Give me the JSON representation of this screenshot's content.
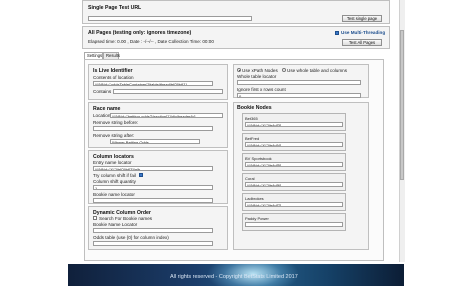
{
  "single_page": {
    "title": "Single Page Test URL",
    "url_value": "",
    "button_label": "Test single page"
  },
  "all_pages": {
    "title": "All Pages (testing only: ignores timezone)",
    "elapsed_text": "Elapsed time: 0.00 , Date : -/--/-- , Date Collection Time: 00:00",
    "multi_threading_label": "Use Multi-Threading",
    "multi_threading_checked": true,
    "button_label": "Test All Pages"
  },
  "tabs": [
    {
      "label": "Settings",
      "active": true
    },
    {
      "label": "Results",
      "active": false
    }
  ],
  "live_identifier": {
    "title": "Is Live Identifier",
    "contents_label": "Contents of location",
    "contents_value": "//*[@id=\"oddsTableContainer\"]/table/thead/tr[0]/td[1]",
    "contains_label": "Contains",
    "contains_value": ""
  },
  "race_name": {
    "title": "Race name",
    "location_label": "Location",
    "location_value": "//*[@id=\"betting-odds\"]/section[1]/div/header/h1",
    "remove_before_label": "Remove string before:",
    "remove_before_value": "",
    "remove_after_label": "Remove string after:",
    "remove_after_value": "Winner Betting Odds"
  },
  "column_locators": {
    "title": "Column locators",
    "entry_label": "Entry name locator",
    "entry_value": "//*[@id=\"t1\"]/tr[0]/td[3]/a/b",
    "try_shift_label": "Try column shift if fail",
    "try_shift_checked": true,
    "shift_qty_label": "Column shift quantity",
    "shift_qty_value": "1",
    "bookie_locator_label": "Bookie name locator",
    "bookie_locator_value": ""
  },
  "dynamic_order": {
    "title": "Dynamic Column Order",
    "search_label": "Search For Bookie names",
    "search_checked": false,
    "bookie_locator_label": "Bookie Name Locator",
    "bookie_locator_value": "",
    "odds_table_label": "Odds table (use {0} for column index)",
    "odds_table_value": ""
  },
  "xpath_mode": {
    "option_xpath_label": "Use xPath Nodes",
    "option_xpath_checked": true,
    "option_whole_label": "Use whole table and columns",
    "option_whole_checked": false,
    "whole_table_label": "Whole table locator",
    "whole_table_value": "",
    "ignore_rows_label": "Ignore first x rows count",
    "ignore_rows_value": "0"
  },
  "bookie_nodes": {
    "title": "Bookie Nodes",
    "items": [
      {
        "name": "Bet365",
        "value": "//*[@id=\"t1\"]/tr/td[3]"
      },
      {
        "name": "BetFred",
        "value": "//*[@id=\"t1\"]/tr/td[4]"
      },
      {
        "name": "BV Sportsbook",
        "value": "//*[@id=\"t1\"]/tr/td[5]"
      },
      {
        "name": "Coral",
        "value": "//*[@id=\"t1\"]/tr/td[6]"
      },
      {
        "name": "Ladbrokes",
        "value": "//*[@id=\"t1\"]/tr/td[7]"
      },
      {
        "name": "Paddy Power",
        "value": ""
      }
    ]
  },
  "footer": {
    "text": "All rights reserved - Copyright BetStats Limited 2017"
  }
}
